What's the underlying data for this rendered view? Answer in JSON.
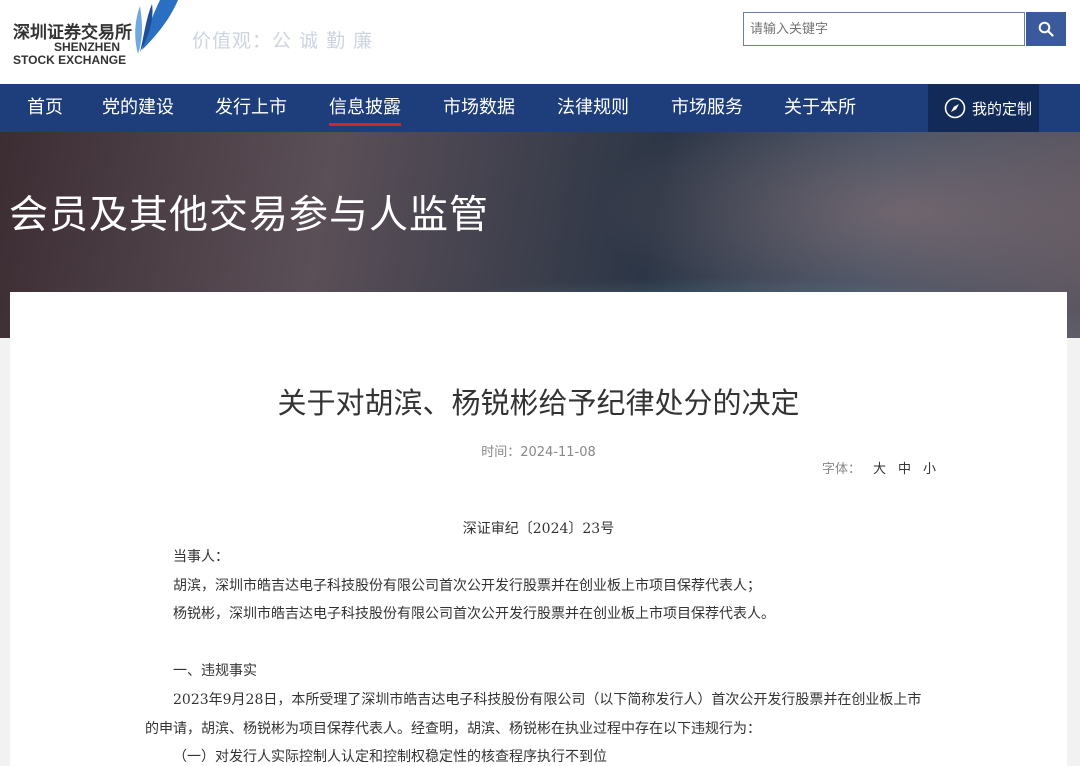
{
  "header": {
    "logo_cn": "深圳证券交易所",
    "logo_en_line1": "SHENZHEN",
    "logo_en_line2": "STOCK EXCHANGE",
    "motto": "价值观：公 诚 勤 廉",
    "search_placeholder": "请输入关键字",
    "search_icon": "search-icon"
  },
  "nav": {
    "items": [
      "首页",
      "党的建设",
      "发行上市",
      "信息披露",
      "市场数据",
      "法律规则",
      "市场服务",
      "关于本所"
    ],
    "active_index": 3,
    "active_color": "#d6261a",
    "my_custom": "我的定制",
    "my_custom_icon": "compass-icon"
  },
  "banner": {
    "title": "会员及其他交易参与人监管"
  },
  "article": {
    "title": "关于对胡滨、杨锐彬给予纪律处分的决定",
    "time_label": "时间：",
    "time_value": "2024-11-08",
    "font_label": "字体：",
    "font_options": [
      "大",
      "中",
      "小"
    ],
    "doc_number": "深证审纪〔2024〕23号",
    "paragraphs": [
      "当事人：",
      "胡滨，深圳市皓吉达电子科技股份有限公司首次公开发行股票并在创业板上市项目保荐代表人；",
      "杨锐彬，深圳市皓吉达电子科技股份有限公司首次公开发行股票并在创业板上市项目保荐代表人。",
      "一、违规事实",
      "2023年9月28日，本所受理了深圳市皓吉达电子科技股份有限公司（以下简称发行人）首次公开发行股票并在创业板上市",
      "的申请，胡滨、杨锐彬为项目保荐代表人。经查明，胡滨、杨锐彬在执业过程中存在以下违规行为：",
      "（一）对发行人实际控制人认定和控制权稳定性的核查程序执行不到位"
    ]
  },
  "colors": {
    "nav_bg": "#1d3e7a",
    "search_button": "#3a5a9c"
  }
}
